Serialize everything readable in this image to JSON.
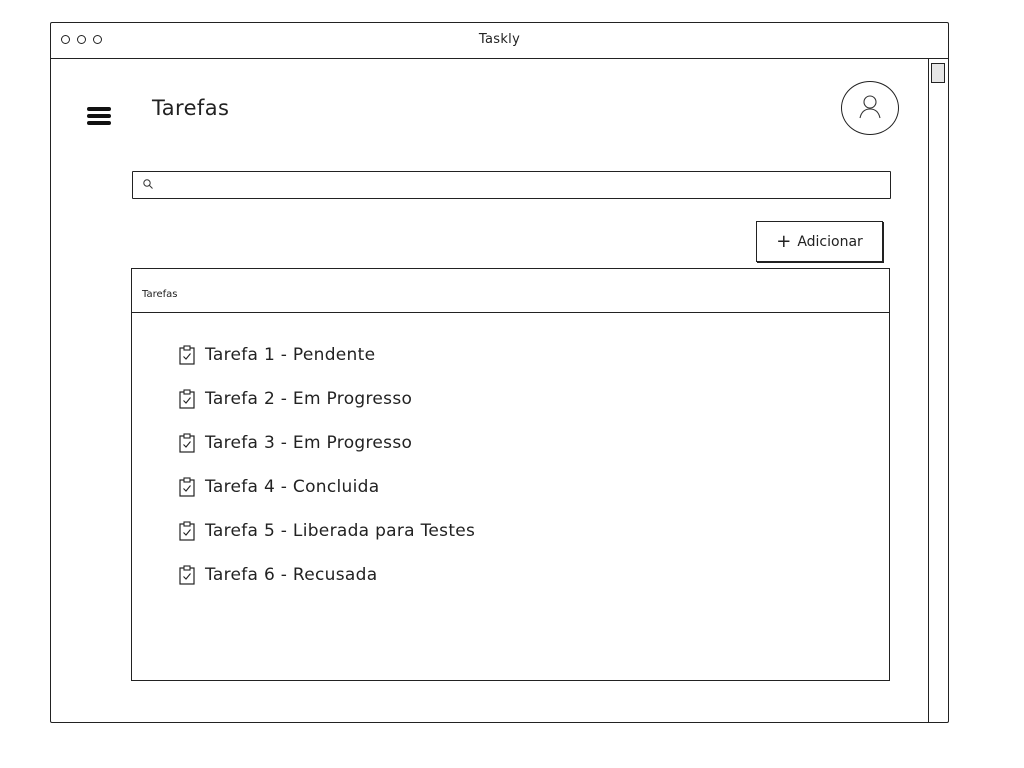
{
  "window": {
    "title": "Taskly"
  },
  "header": {
    "menu_icon": "hamburger-menu-icon",
    "title": "Tarefas",
    "avatar_icon": "user-avatar-icon"
  },
  "search": {
    "icon": "search-icon",
    "value": "",
    "placeholder": ""
  },
  "toolbar": {
    "add_icon": "plus-icon",
    "add_label": "Adicionar"
  },
  "panel": {
    "title": "Tarefas",
    "item_icon": "clipboard-check-icon",
    "items": [
      {
        "label": "Tarefa 1 - Pendente"
      },
      {
        "label": "Tarefa 2 - Em Progresso"
      },
      {
        "label": "Tarefa 3 - Em Progresso"
      },
      {
        "label": "Tarefa 4 - Concluida"
      },
      {
        "label": "Tarefa 5 - Liberada para Testes"
      },
      {
        "label": "Tarefa 6 - Recusada"
      }
    ]
  }
}
